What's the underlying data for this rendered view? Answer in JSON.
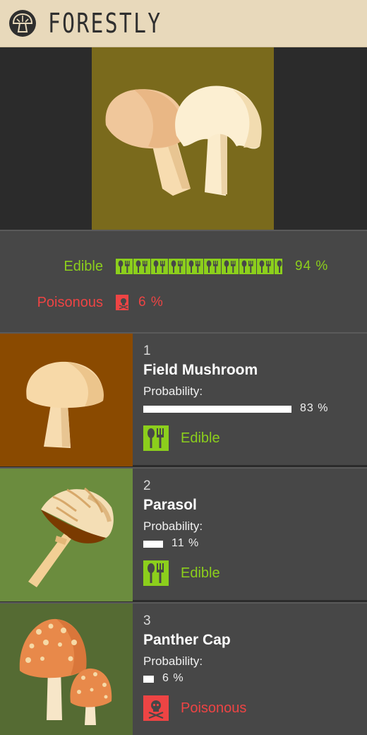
{
  "header": {
    "brand": "FORESTLY",
    "logo_icon": "mushroom-logo-icon"
  },
  "colors": {
    "header_bg": "#e8d9bb",
    "panel_bg": "#474747",
    "edible": "#8ccf1c",
    "poisonous": "#ee4444",
    "hero_bg": "#7a6a1c"
  },
  "summary": {
    "edible": {
      "label": "Edible",
      "percent": "94 %",
      "value": 0.94,
      "icon": "fork-spoon-icon"
    },
    "poisonous": {
      "label": "Poisonous",
      "percent": "6 %",
      "value": 0.06,
      "icon": "skull-icon"
    }
  },
  "results": [
    {
      "rank": "1",
      "name": "Field Mushroom",
      "prob_label": "Probability:",
      "percent": "83 %",
      "value": 0.83,
      "classification": "Edible",
      "class_icon": "fork-spoon-icon",
      "image_bg": "#8a4a00"
    },
    {
      "rank": "2",
      "name": "Parasol",
      "prob_label": "Probability:",
      "percent": "11 %",
      "value": 0.11,
      "classification": "Edible",
      "class_icon": "fork-spoon-icon",
      "image_bg": "#6b8c3e"
    },
    {
      "rank": "3",
      "name": "Panther Cap",
      "prob_label": "Probability:",
      "percent": "6 %",
      "value": 0.06,
      "classification": "Poisonous",
      "class_icon": "skull-icon",
      "image_bg": "#556b33"
    }
  ]
}
